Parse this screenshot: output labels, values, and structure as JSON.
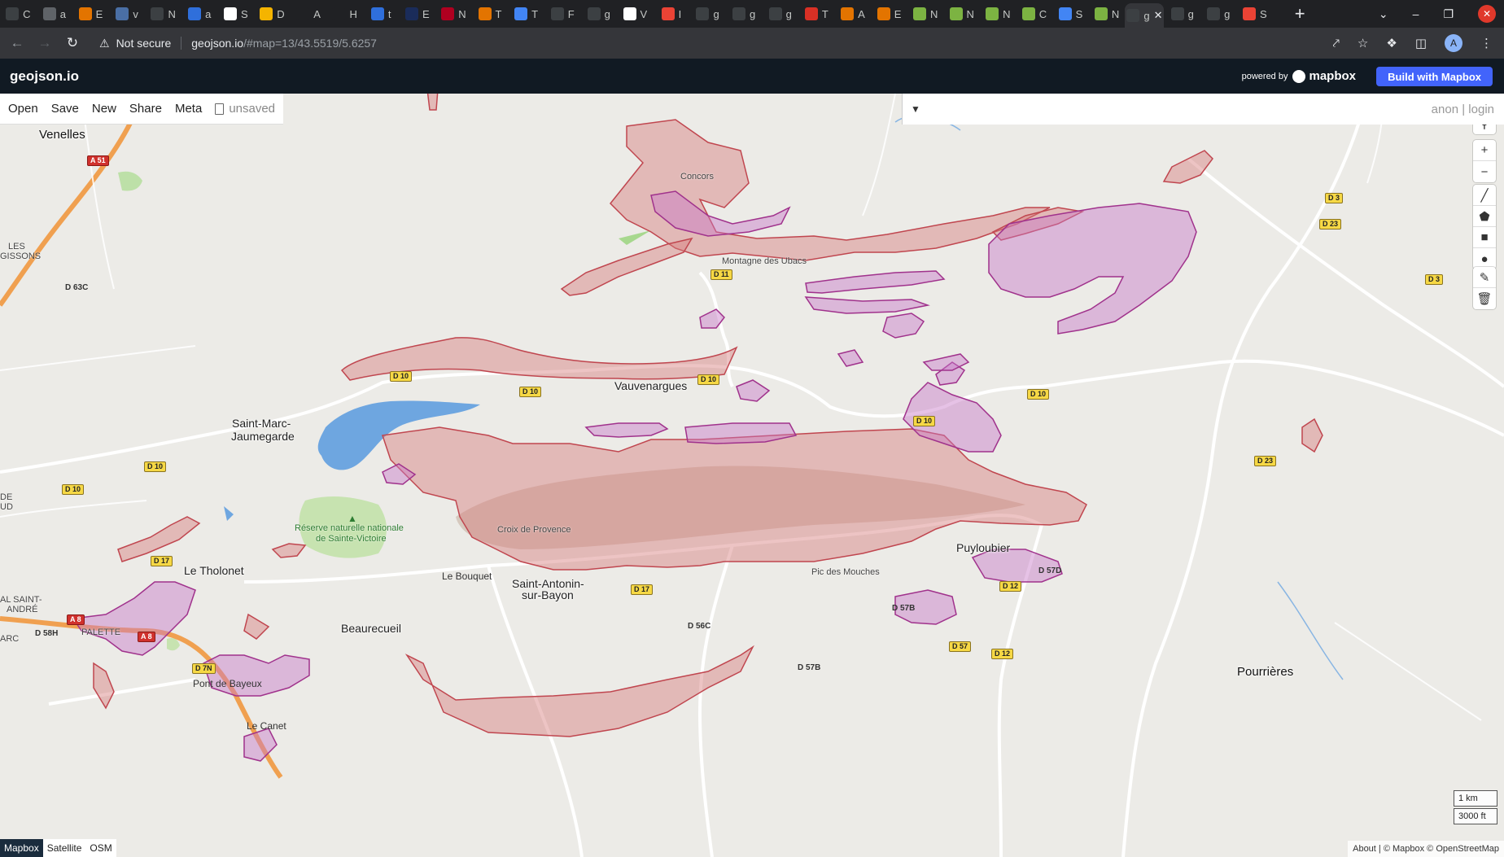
{
  "browser": {
    "tabs": [
      {
        "letter": "C",
        "color": "#3c4043"
      },
      {
        "letter": "a",
        "color": "#5f6368"
      },
      {
        "letter": "E",
        "color": "#e37400"
      },
      {
        "letter": "v",
        "color": "#4a6fa5"
      },
      {
        "letter": "N",
        "color": "#3c4043"
      },
      {
        "letter": "a",
        "color": "#2f6fdb"
      },
      {
        "letter": "S",
        "color": "#fff"
      },
      {
        "letter": "D",
        "color": "#f5b400"
      },
      {
        "letter": "A",
        "color": "#202124"
      },
      {
        "letter": "H",
        "color": "#202124"
      },
      {
        "letter": "t",
        "color": "#2f6fdb"
      },
      {
        "letter": "E",
        "color": "#1a2c5a"
      },
      {
        "letter": "N",
        "color": "#b00020"
      },
      {
        "letter": "T",
        "color": "#e37400"
      },
      {
        "letter": "T",
        "color": "#4285f4"
      },
      {
        "letter": "F",
        "color": "#3c4043"
      },
      {
        "letter": "g",
        "color": "#3c4043"
      },
      {
        "letter": "V",
        "color": "#fff"
      },
      {
        "letter": "I",
        "color": "#ea4335"
      },
      {
        "letter": "g",
        "color": "#3c4043"
      },
      {
        "letter": "g",
        "color": "#3c4043"
      },
      {
        "letter": "g",
        "color": "#3c4043"
      },
      {
        "letter": "T",
        "color": "#d93025"
      },
      {
        "letter": "A",
        "color": "#e37400"
      },
      {
        "letter": "E",
        "color": "#e37400"
      },
      {
        "letter": "N",
        "color": "#7cb342"
      },
      {
        "letter": "N",
        "color": "#7cb342"
      },
      {
        "letter": "N",
        "color": "#7cb342"
      },
      {
        "letter": "C",
        "color": "#7cb342"
      },
      {
        "letter": "S",
        "color": "#4285f4"
      },
      {
        "letter": "N",
        "color": "#7cb342"
      },
      {
        "letter": "g",
        "color": "#3c4043",
        "active": true
      },
      {
        "letter": "g",
        "color": "#3c4043"
      },
      {
        "letter": "g",
        "color": "#3c4043"
      },
      {
        "letter": "S",
        "color": "#ea4335"
      }
    ],
    "new_tab": "+",
    "not_secure": "Not secure",
    "url_host": "geojson.io",
    "url_rest": "/#map=13/43.5519/5.6257",
    "profile_initial": "A"
  },
  "app": {
    "title": "geojson.io",
    "powered_by": "powered by",
    "mapbox_brand": "mapbox",
    "build_button": "Build with Mapbox"
  },
  "toolbar": {
    "open": "Open",
    "save": "Save",
    "new": "New",
    "share": "Share",
    "meta": "Meta",
    "unsaved": "unsaved"
  },
  "panel": {
    "user": "anon",
    "separator": "|",
    "login": "login"
  },
  "scale": {
    "metric": "1 km",
    "imperial": "3000 ft"
  },
  "layers": {
    "mapbox": "Mapbox",
    "satellite": "Satellite",
    "osm": "OSM"
  },
  "attribution": "About | © Mapbox © OpenStreetMap",
  "places": {
    "venelles": "Venelles",
    "concors": "Concors",
    "ubacs": "Montagne des Ubacs",
    "vauvenargues": "Vauvenargues",
    "saint_marc_1": "Saint-Marc-",
    "saint_marc_2": "Jaumegarde",
    "pic_mouches": "Pic des Mouches",
    "croix": "Croix de Provence",
    "reserve_1": "Réserve naturelle nationale",
    "reserve_2": "de Sainte-Victoire",
    "tholonet": "Le Tholonet",
    "bouquet": "Le Bouquet",
    "saint_antonin_1": "Saint-Antonin-",
    "saint_antonin_2": "sur-Bayon",
    "puyloubier": "Puyloubier",
    "beaurecueil": "Beaurecueil",
    "pont_bayeux": "Pont de Bayeux",
    "pourrieres": "Pourrières",
    "palette": "PALETTE",
    "les": "LES",
    "gissons": "GISSONS",
    "saint_andre_1": "AL SAINT-",
    "saint_andre_2": "ANDRÉ",
    "de_ud_1": "DE",
    "de_ud_2": "UD",
    "arc": "ARC",
    "le_canet": "Le Canet"
  },
  "roads": {
    "a51": "A 51",
    "a8": "A 8",
    "a8b": "A 8",
    "d63c": "D 63C",
    "d11": "D 11",
    "d10a": "D 10",
    "d10b": "D 10",
    "d10c": "D 10",
    "d10d": "D 10",
    "d10e": "D 10",
    "d10f": "D 10",
    "d10g": "D 10",
    "d17a": "D 17",
    "d17b": "D 17",
    "d3a": "D 3",
    "d3b": "D 3",
    "d23a": "D 23",
    "d23b": "D 23",
    "d12a": "D 12",
    "d12b": "D 12",
    "d57": "D 57",
    "d57b1": "D 57B",
    "d57b2": "D 57B",
    "d57d": "D 57D",
    "d56c": "D 56C",
    "d7n": "D 7N",
    "d58h": "D 58H"
  }
}
